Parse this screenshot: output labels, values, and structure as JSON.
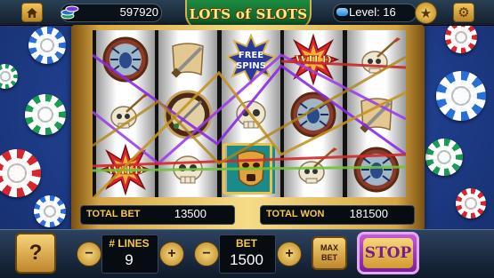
{
  "top_bar": {
    "coins": "597920",
    "logo": "LOTS of SLOTS",
    "level_label": "Level: 16",
    "level_progress": 0.15
  },
  "reels": [
    [
      "spider-orb",
      "skull-arrow",
      "wild-burst"
    ],
    [
      "scroll-dagger",
      "dagger-shield",
      "skull"
    ],
    [
      "free-spins",
      "skull",
      "golden-mask"
    ],
    [
      "wild-burst",
      "spider-orb",
      "skull-arrow"
    ],
    [
      "skull-arrow",
      "scroll-dagger",
      "spider-orb"
    ]
  ],
  "symbol_text": {
    "free_spins": [
      "FREE",
      "SPINS"
    ],
    "wild": "WILD"
  },
  "totals": {
    "total_bet_label": "TOTAL BET",
    "total_bet_value": "13500",
    "total_won_label": "TOTAL WON",
    "total_won_value": "181500"
  },
  "controls": {
    "help_label": "?",
    "minus": "−",
    "plus": "+",
    "lines_label": "# LINES",
    "lines_value": "9",
    "bet_label": "BET",
    "bet_value": "1500",
    "max_bet_label": "MAX BET",
    "spin_label": "STOP"
  },
  "colors": {
    "felt": "#1f3f8a",
    "gold": "#d7a746",
    "label_gold": "#f5c948",
    "spin_purple": "#7b1d9a",
    "line_purple": "#8a2be2",
    "line_red": "#d22a2a",
    "line_green": "#6fc23a",
    "line_gold": "#c39422"
  }
}
